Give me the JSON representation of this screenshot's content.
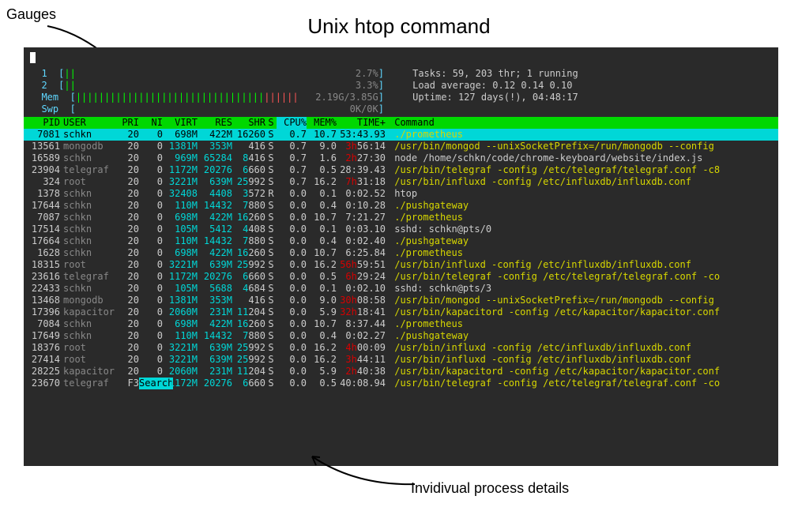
{
  "title": "Unix htop command",
  "labels": {
    "gauges": "Gauges",
    "details": "Invidivual process details"
  },
  "gauges": {
    "cpu1": {
      "n": "1",
      "bars": "||",
      "pct": "2.7%"
    },
    "cpu2": {
      "n": "2",
      "bars": "||",
      "pct": "3.3%"
    },
    "mem": {
      "lbl": "Mem",
      "green": "|||||||||||||||||||||||||||||||||",
      "red": "||||||",
      "pct": "2.19G/3.85G"
    },
    "swp": {
      "lbl": "Swp",
      "pct": "0K/0K"
    }
  },
  "summary": {
    "tasks_k": "Tasks:",
    "tasks_v": "59",
    "thr_v": "203",
    "thr_t": "thr;",
    "run_v": "1",
    "run_t": "running",
    "load_k": "Load average:",
    "l1": "0.12",
    "l2": "0.14",
    "l3": "0.10",
    "uptime_k": "Uptime:",
    "uptime_v": "127 days(!), 04:48:17"
  },
  "headers": {
    "pid": "PID",
    "user": "USER",
    "pri": "PRI",
    "ni": "NI",
    "virt": "VIRT",
    "res": "RES",
    "shr": "SHR",
    "s": "S",
    "cpu": "CPU%",
    "mem": "MEM%",
    "time": "TIME+",
    "cmd": "Command"
  },
  "procs": [
    {
      "pid": "7081",
      "user": "schkn",
      "pri": "20",
      "ni": "0",
      "virt": "698M",
      "res": "422M",
      "shr_hi": "16",
      "shr": "260",
      "s": "S",
      "cpu": "0.7",
      "mem": "10.7",
      "time_r": "",
      "time": "53:43.93",
      "cmd": "./prometheus",
      "cmdcol": "y",
      "sel": true
    },
    {
      "pid": "13561",
      "user": "mongodb",
      "pri": "20",
      "ni": "0",
      "virt": "1381M",
      "res": "353M",
      "shr_hi": "",
      "shr": "416",
      "s": "S",
      "cpu": "0.7",
      "mem": "9.0",
      "time_r": "3h",
      "time": "56:14",
      "cmd": "/usr/bin/mongod --unixSocketPrefix=/run/mongodb --config",
      "cmdcol": "y"
    },
    {
      "pid": "16589",
      "user": "schkn",
      "pri": "20",
      "ni": "0",
      "virt": "969M",
      "res_hi": "65",
      "res": "284",
      "shr_hi": "8",
      "shr": "416",
      "s": "S",
      "cpu": "0.7",
      "mem": "1.6",
      "time_r": "2h",
      "time": "27:30",
      "cmd": "node /home/schkn/code/chrome-keyboard/website/index.js",
      "cmdcol": "w"
    },
    {
      "pid": "23904",
      "user": "telegraf",
      "pri": "20",
      "ni": "0",
      "virt": "1172M",
      "res_hi": "20",
      "res": "276",
      "shr_hi": "6",
      "shr": "660",
      "s": "S",
      "cpu": "0.7",
      "mem": "0.5",
      "time_r": "",
      "time": "28:39.43",
      "cmd": "/usr/bin/telegraf -config /etc/telegraf/telegraf.conf -c8",
      "cmdcol": "y"
    },
    {
      "pid": "324",
      "user": "root",
      "pri": "20",
      "ni": "0",
      "virt": "3221M",
      "res": "639M",
      "shr_hi": "25",
      "shr": "992",
      "s": "S",
      "cpu": "0.7",
      "mem": "16.2",
      "time_r": "7h",
      "time": "31:18",
      "cmd": "/usr/bin/influxd -config /etc/influxdb/influxdb.conf",
      "cmdcol": "y"
    },
    {
      "pid": "1378",
      "user": "schkn",
      "pri": "20",
      "ni": "0",
      "virt_hi": "32",
      "virt": "408",
      "res_hi": "4",
      "res": "408",
      "shr_hi": "3",
      "shr": "572",
      "s": "R",
      "cpu": "0.0",
      "mem": "0.1",
      "time_r": "",
      "time": "0:02.52",
      "cmd": "htop",
      "cmdcol": "w"
    },
    {
      "pid": "17644",
      "user": "schkn",
      "pri": "20",
      "ni": "0",
      "virt": "110M",
      "res_hi": "14",
      "res": "432",
      "shr_hi": "7",
      "shr": "880",
      "s": "S",
      "cpu": "0.0",
      "mem": "0.4",
      "time_r": "",
      "time": "0:10.28",
      "cmd": "./pushgateway",
      "cmdcol": "y"
    },
    {
      "pid": "7087",
      "user": "schkn",
      "pri": "20",
      "ni": "0",
      "virt": "698M",
      "res": "422M",
      "shr_hi": "16",
      "shr": "260",
      "s": "S",
      "cpu": "0.0",
      "mem": "10.7",
      "time_r": "",
      "time": "7:21.27",
      "cmd": "./prometheus",
      "cmdcol": "y"
    },
    {
      "pid": "17514",
      "user": "schkn",
      "pri": "20",
      "ni": "0",
      "virt": "105M",
      "res_hi": "5",
      "res": "412",
      "shr_hi": "4",
      "shr": "408",
      "s": "S",
      "cpu": "0.0",
      "mem": "0.1",
      "time_r": "",
      "time": "0:03.10",
      "cmd": "sshd: schkn@pts/0",
      "cmdcol": "w"
    },
    {
      "pid": "17664",
      "user": "schkn",
      "pri": "20",
      "ni": "0",
      "virt": "110M",
      "res_hi": "14",
      "res": "432",
      "shr_hi": "7",
      "shr": "880",
      "s": "S",
      "cpu": "0.0",
      "mem": "0.4",
      "time_r": "",
      "time": "0:02.40",
      "cmd": "./pushgateway",
      "cmdcol": "y"
    },
    {
      "pid": "1628",
      "user": "schkn",
      "pri": "20",
      "ni": "0",
      "virt": "698M",
      "res": "422M",
      "shr_hi": "16",
      "shr": "260",
      "s": "S",
      "cpu": "0.0",
      "mem": "10.7",
      "time_r": "",
      "time": "6:25.84",
      "cmd": "./prometheus",
      "cmdcol": "y"
    },
    {
      "pid": "18315",
      "user": "root",
      "pri": "20",
      "ni": "0",
      "virt": "3221M",
      "res": "639M",
      "shr_hi": "25",
      "shr": "992",
      "s": "S",
      "cpu": "0.0",
      "mem": "16.2",
      "time_r": "56h",
      "time": "59:51",
      "cmd": "/usr/bin/influxd -config /etc/influxdb/influxdb.conf",
      "cmdcol": "y"
    },
    {
      "pid": "23616",
      "user": "telegraf",
      "pri": "20",
      "ni": "0",
      "virt": "1172M",
      "res_hi": "20",
      "res": "276",
      "shr_hi": "6",
      "shr": "660",
      "s": "S",
      "cpu": "0.0",
      "mem": "0.5",
      "time_r": "6h",
      "time": "29:24",
      "cmd": "/usr/bin/telegraf -config /etc/telegraf/telegraf.conf -co",
      "cmdcol": "y"
    },
    {
      "pid": "22433",
      "user": "schkn",
      "pri": "20",
      "ni": "0",
      "virt": "105M",
      "res_hi": "5",
      "res": "688",
      "shr_hi": "4",
      "shr": "684",
      "s": "S",
      "cpu": "0.0",
      "mem": "0.1",
      "time_r": "",
      "time": "0:02.10",
      "cmd": "sshd: schkn@pts/3",
      "cmdcol": "w"
    },
    {
      "pid": "13468",
      "user": "mongodb",
      "pri": "20",
      "ni": "0",
      "virt": "1381M",
      "res": "353M",
      "shr_hi": "",
      "shr": "416",
      "s": "S",
      "cpu": "0.0",
      "mem": "9.0",
      "time_r": "30h",
      "time": "08:58",
      "cmd": "/usr/bin/mongod --unixSocketPrefix=/run/mongodb --config",
      "cmdcol": "y"
    },
    {
      "pid": "17396",
      "user": "kapacitor",
      "pri": "20",
      "ni": "0",
      "virt": "2060M",
      "res": "231M",
      "shr_hi": "11",
      "shr": "204",
      "s": "S",
      "cpu": "0.0",
      "mem": "5.9",
      "time_r": "32h",
      "time": "18:41",
      "cmd": "/usr/bin/kapacitord -config /etc/kapacitor/kapacitor.conf",
      "cmdcol": "y"
    },
    {
      "pid": "7084",
      "user": "schkn",
      "pri": "20",
      "ni": "0",
      "virt": "698M",
      "res": "422M",
      "shr_hi": "16",
      "shr": "260",
      "s": "S",
      "cpu": "0.0",
      "mem": "10.7",
      "time_r": "",
      "time": "8:37.44",
      "cmd": "./prometheus",
      "cmdcol": "y"
    },
    {
      "pid": "17649",
      "user": "schkn",
      "pri": "20",
      "ni": "0",
      "virt": "110M",
      "res_hi": "14",
      "res": "432",
      "shr_hi": "7",
      "shr": "880",
      "s": "S",
      "cpu": "0.0",
      "mem": "0.4",
      "time_r": "",
      "time": "0:02.27",
      "cmd": "./pushgateway",
      "cmdcol": "y"
    },
    {
      "pid": "18376",
      "user": "root",
      "pri": "20",
      "ni": "0",
      "virt": "3221M",
      "res": "639M",
      "shr_hi": "25",
      "shr": "992",
      "s": "S",
      "cpu": "0.0",
      "mem": "16.2",
      "time_r": "4h",
      "time": "00:09",
      "cmd": "/usr/bin/influxd -config /etc/influxdb/influxdb.conf",
      "cmdcol": "y"
    },
    {
      "pid": "27414",
      "user": "root",
      "pri": "20",
      "ni": "0",
      "virt": "3221M",
      "res": "639M",
      "shr_hi": "25",
      "shr": "992",
      "s": "S",
      "cpu": "0.0",
      "mem": "16.2",
      "time_r": "3h",
      "time": "44:11",
      "cmd": "/usr/bin/influxd -config /etc/influxdb/influxdb.conf",
      "cmdcol": "y"
    },
    {
      "pid": "28225",
      "user": "kapacitor",
      "pri": "20",
      "ni": "0",
      "virt": "2060M",
      "res": "231M",
      "shr_hi": "11",
      "shr": "204",
      "s": "S",
      "cpu": "0.0",
      "mem": "5.9",
      "time_r": "2h",
      "time": "40:38",
      "cmd": "/usr/bin/kapacitord -config /etc/kapacitor/kapacitor.conf",
      "cmdcol": "y"
    },
    {
      "pid": "23670",
      "user": "telegraf",
      "pri": "F3",
      "ni": "",
      "virt": "1172M",
      "res_hi": "20",
      "res": "276",
      "shr_hi": "6",
      "shr": "660",
      "s": "S",
      "cpu": "0.0",
      "mem": "0.5",
      "time_r": "",
      "time": "40:08.94",
      "cmd": "/usr/bin/telegraf -config /etc/telegraf/telegraf.conf -co",
      "cmdcol": "y",
      "search": "Search"
    }
  ]
}
